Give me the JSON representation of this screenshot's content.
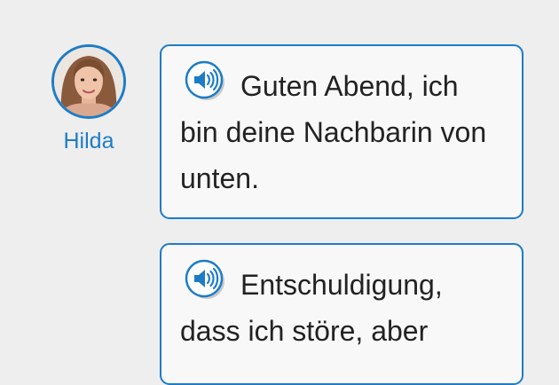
{
  "speaker": {
    "name": "Hilda",
    "avatar_icon": "woman-portrait-avatar"
  },
  "messages": [
    {
      "text": "Guten Abend, ich bin deine Nachbarin von unten.",
      "icon": "speaker-audio-icon"
    },
    {
      "text": "Entschuldigung, dass ich störe, aber",
      "icon": "speaker-audio-icon"
    }
  ],
  "colors": {
    "accent": "#1e7cc6",
    "bubble_bg": "#f8f8f8",
    "page_bg": "#eeeeee",
    "text": "#222222"
  }
}
